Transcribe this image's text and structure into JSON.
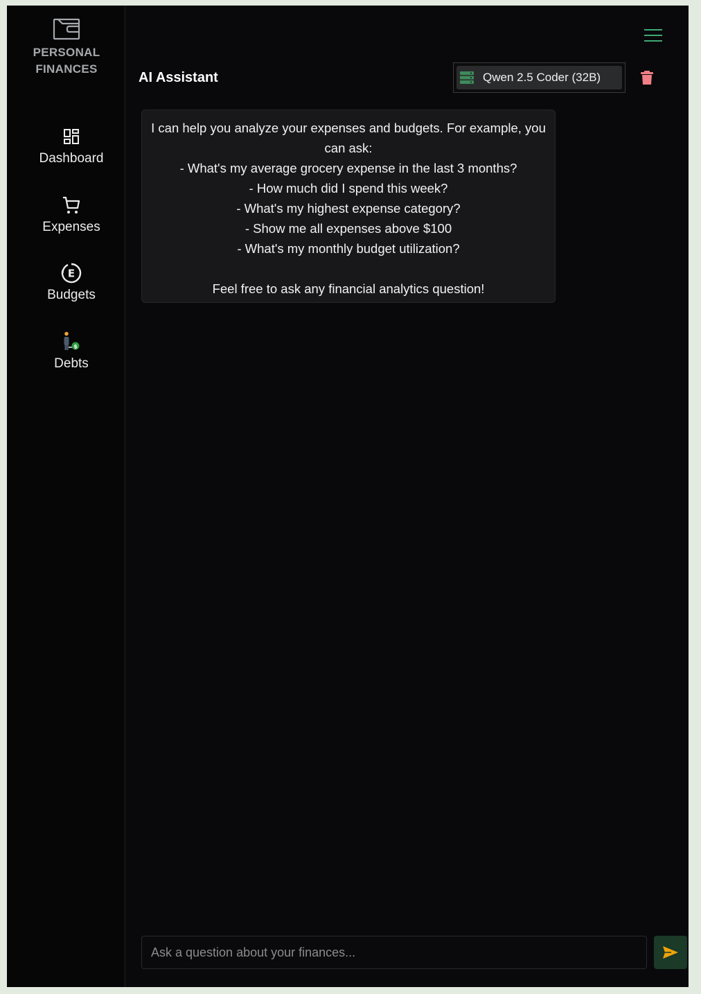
{
  "sidebar": {
    "logo_line1": "PERSONAL",
    "logo_line2": "FINANCES",
    "items": [
      {
        "label": "Dashboard",
        "icon": "dashboard-icon"
      },
      {
        "label": "Expenses",
        "icon": "cart-icon"
      },
      {
        "label": "Budgets",
        "icon": "euro-coin-icon"
      },
      {
        "label": "Debts",
        "icon": "person-money-icon"
      }
    ]
  },
  "header": {
    "title": "AI Assistant",
    "model_label": "Qwen 2.5 Coder (32B)",
    "menu_icon": "hamburger-icon",
    "clear_icon": "trash-icon"
  },
  "chat": {
    "assistant_message": [
      "I can help you analyze your expenses and budgets. For example, you can ask:",
      "- What's my average grocery expense in the last 3 months?",
      "- How much did I spend this week?",
      "- What's my highest expense category?",
      "- Show me all expenses above $100",
      "- What's my monthly budget utilization?",
      "",
      "Feel free to ask any financial analytics question!"
    ]
  },
  "composer": {
    "placeholder": "Ask a question about your finances...",
    "send_icon": "send-arrow-icon"
  },
  "colors": {
    "accent_green": "#3ea873",
    "send_arrow": "#f0a30a",
    "trash": "#f07f86",
    "background": "#09090b"
  }
}
